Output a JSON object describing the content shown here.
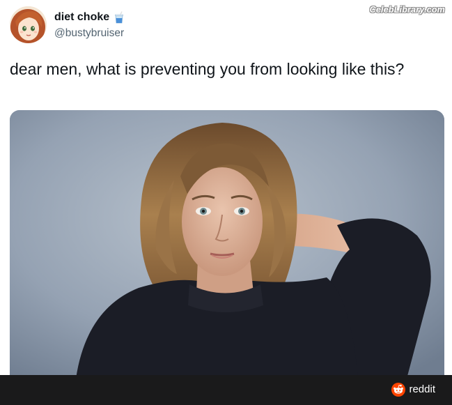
{
  "tweet": {
    "display_name": "diet choke",
    "handle": "@bustybruiser",
    "text": "dear men, what is preventing you from looking like this?",
    "name_emoji_icon": "cup-with-straw-icon",
    "avatar_icon": "anime-avatar-icon"
  },
  "watermark": {
    "text": "CelebLibrary.com"
  },
  "footer": {
    "brand_label": "reddit",
    "brand_icon": "reddit-logo-icon",
    "bar_color": "#1a1a1b",
    "icon_color": "#ff4500"
  },
  "photo": {
    "background_color": "#8e9caf",
    "sweater_color": "#1b1d26"
  }
}
